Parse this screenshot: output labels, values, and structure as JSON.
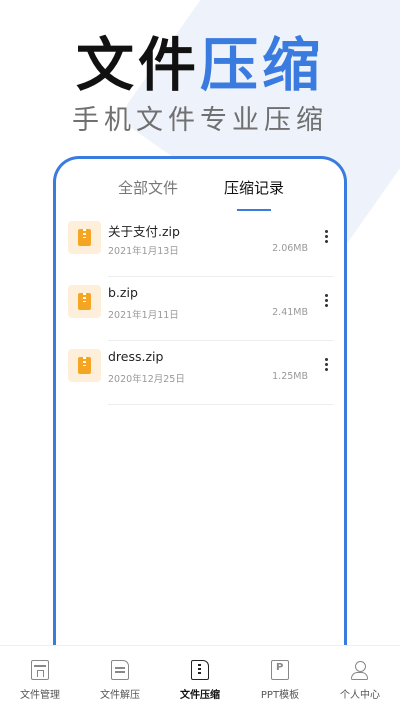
{
  "promo": {
    "title_dark": "文件",
    "title_accent": "压缩",
    "subtitle": "手机文件专业压缩"
  },
  "tabs": [
    {
      "label": "全部文件",
      "active": false
    },
    {
      "label": "压缩记录",
      "active": true
    }
  ],
  "files": [
    {
      "name": "关于支付.zip",
      "date": "2021年1月13日",
      "size": "2.06MB",
      "icon": "zip-file-icon"
    },
    {
      "name": "b.zip",
      "date": "2021年1月11日",
      "size": "2.41MB",
      "icon": "zip-file-icon"
    },
    {
      "name": "dress.zip",
      "date": "2020年12月25日",
      "size": "1.25MB",
      "icon": "zip-file-icon"
    }
  ],
  "nav": [
    {
      "label": "文件管理",
      "icon": "folder-manage-icon",
      "active": false
    },
    {
      "label": "文件解压",
      "icon": "file-extract-icon",
      "active": false
    },
    {
      "label": "文件压缩",
      "icon": "file-compress-icon",
      "active": true
    },
    {
      "label": "PPT模板",
      "icon": "ppt-template-icon",
      "active": false
    },
    {
      "label": "个人中心",
      "icon": "user-icon",
      "active": false
    }
  ],
  "colors": {
    "accent": "#3a7be0",
    "zip_icon": "#f5a524",
    "zip_icon_bg": "#fdefd9"
  }
}
